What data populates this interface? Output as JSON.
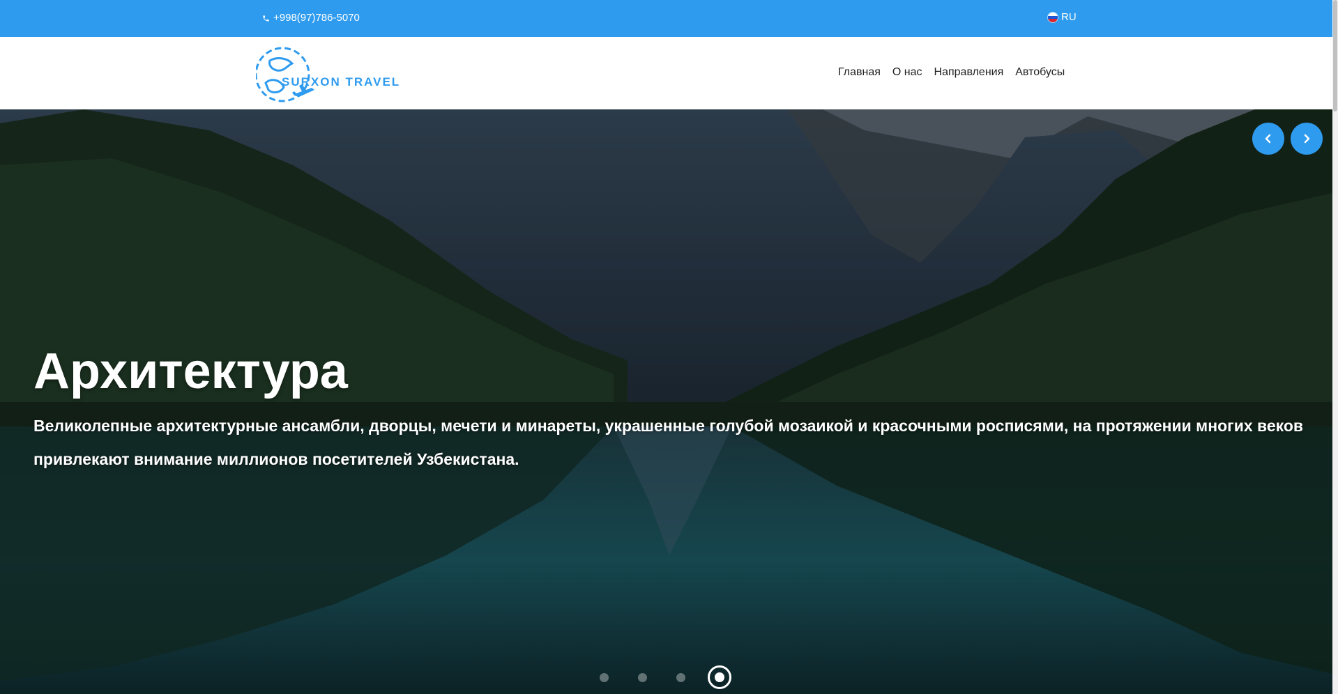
{
  "topbar": {
    "phone": "+998(97)786-5070",
    "language": "RU"
  },
  "header": {
    "logo_text": "SURXON TRAVEL",
    "nav": [
      {
        "label": "Главная"
      },
      {
        "label": "О нас"
      },
      {
        "label": "Направления"
      },
      {
        "label": "Автобусы"
      }
    ]
  },
  "hero": {
    "title": "Архитектура",
    "text": "Великолепные архитектурные ансамбли, дворцы, мечети и минареты, украшенные голубой мозаикой и красочными росписями, на протяжении многих веков привлекают внимание миллионов посетителей Узбекистана.",
    "slide_count": 4,
    "active_slide": 4
  },
  "colors": {
    "accent": "#2e9bef",
    "nav_text": "#222222"
  },
  "icons": {
    "phone": "phone-icon",
    "flag": "russia-flag-icon",
    "prev": "chevron-left-icon",
    "next": "chevron-right-icon"
  }
}
